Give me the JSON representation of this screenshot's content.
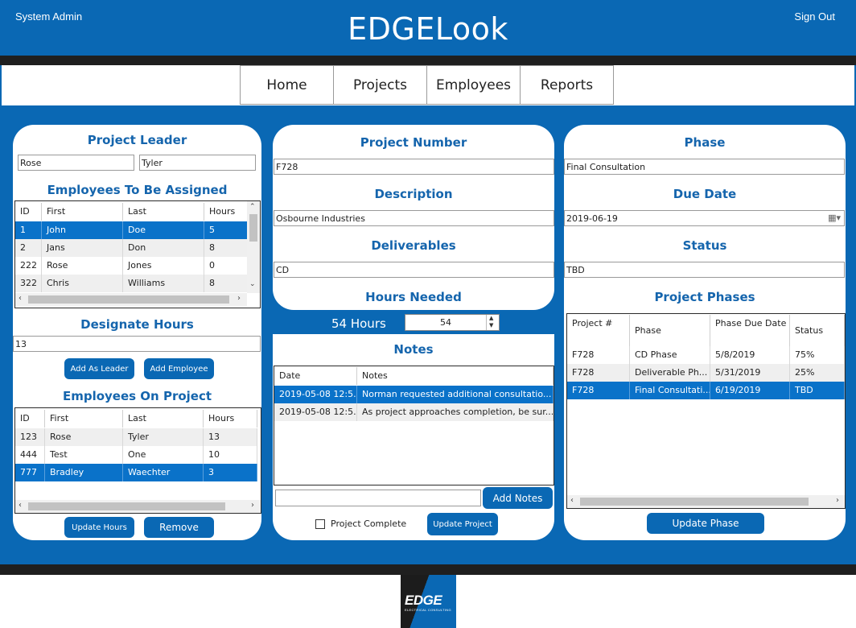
{
  "header": {
    "user": "System Admin",
    "title": "EDGELook",
    "sign_out": "Sign Out"
  },
  "nav": [
    "Home",
    "Projects",
    "Employees",
    "Reports"
  ],
  "left": {
    "project_leader_heading": "Project Leader",
    "leader_first": "Rose",
    "leader_last": "Tyler",
    "assign_heading": "Employees To Be Assigned",
    "assign_columns": [
      "ID",
      "First",
      "Last",
      "Hours"
    ],
    "assign_rows": [
      [
        "1",
        "John",
        "Doe",
        "5"
      ],
      [
        "2",
        "Jans",
        "Don",
        "8"
      ],
      [
        "222",
        "Rose",
        "Jones",
        "0"
      ],
      [
        "322",
        "Chris",
        "Williams",
        "8"
      ]
    ],
    "designate_heading": "Designate Hours",
    "designate_value": "13",
    "add_leader": "Add As Leader",
    "add_employee": "Add Employee",
    "on_project_heading": "Employees On Project",
    "on_project_columns": [
      "ID",
      "First",
      "Last",
      "Hours"
    ],
    "on_project_rows": [
      [
        "123",
        "Rose",
        "Tyler",
        "13"
      ],
      [
        "444",
        "Test",
        "One",
        "10"
      ],
      [
        "777",
        "Bradley",
        "Waechter",
        "3"
      ]
    ],
    "update_hours": "Update Hours",
    "remove": "Remove"
  },
  "middle": {
    "project_number_heading": "Project Number",
    "project_number": "F728",
    "description_heading": "Description",
    "description": "Osbourne Industries",
    "deliverables_heading": "Deliverables",
    "deliverables": "CD",
    "hours_heading": "Hours Needed",
    "hours_label": "54 Hours",
    "hours_value": "54",
    "notes_heading": "Notes",
    "notes_columns": [
      "Date",
      "Notes"
    ],
    "notes_rows": [
      [
        "2019-05-08 12:5...",
        "Norman requested additional consultatio..."
      ],
      [
        "2019-05-08 12:5...",
        "As project approaches completion, be sur..."
      ]
    ],
    "new_note": "",
    "add_notes": "Add Notes",
    "project_complete": "Project Complete",
    "update_project": "Update Project"
  },
  "right": {
    "phase_heading": "Phase",
    "phase": "Final Consultation",
    "due_heading": "Due Date",
    "due_date": "2019-06-19",
    "status_heading": "Status",
    "status": "TBD",
    "phases_heading": "Project Phases",
    "phases_columns": [
      "Project #",
      "Phase",
      "Phase Due Date",
      "Status"
    ],
    "phases_rows": [
      [
        "F728",
        "CD Phase",
        "5/8/2019",
        "75%"
      ],
      [
        "F728",
        "Deliverable Ph...",
        "5/31/2019",
        "25%"
      ],
      [
        "F728",
        "Final Consultati...",
        "6/19/2019",
        "TBD"
      ]
    ],
    "update_phase": "Update Phase"
  },
  "footer": {
    "logo_text": "EDGE",
    "logo_tagline": "ELECTRICAL CONSULTING"
  },
  "colors": {
    "brand": "#0a68b4",
    "selection": "#0a72c9",
    "dark": "#1f1f1f",
    "heading": "#1565ad"
  }
}
